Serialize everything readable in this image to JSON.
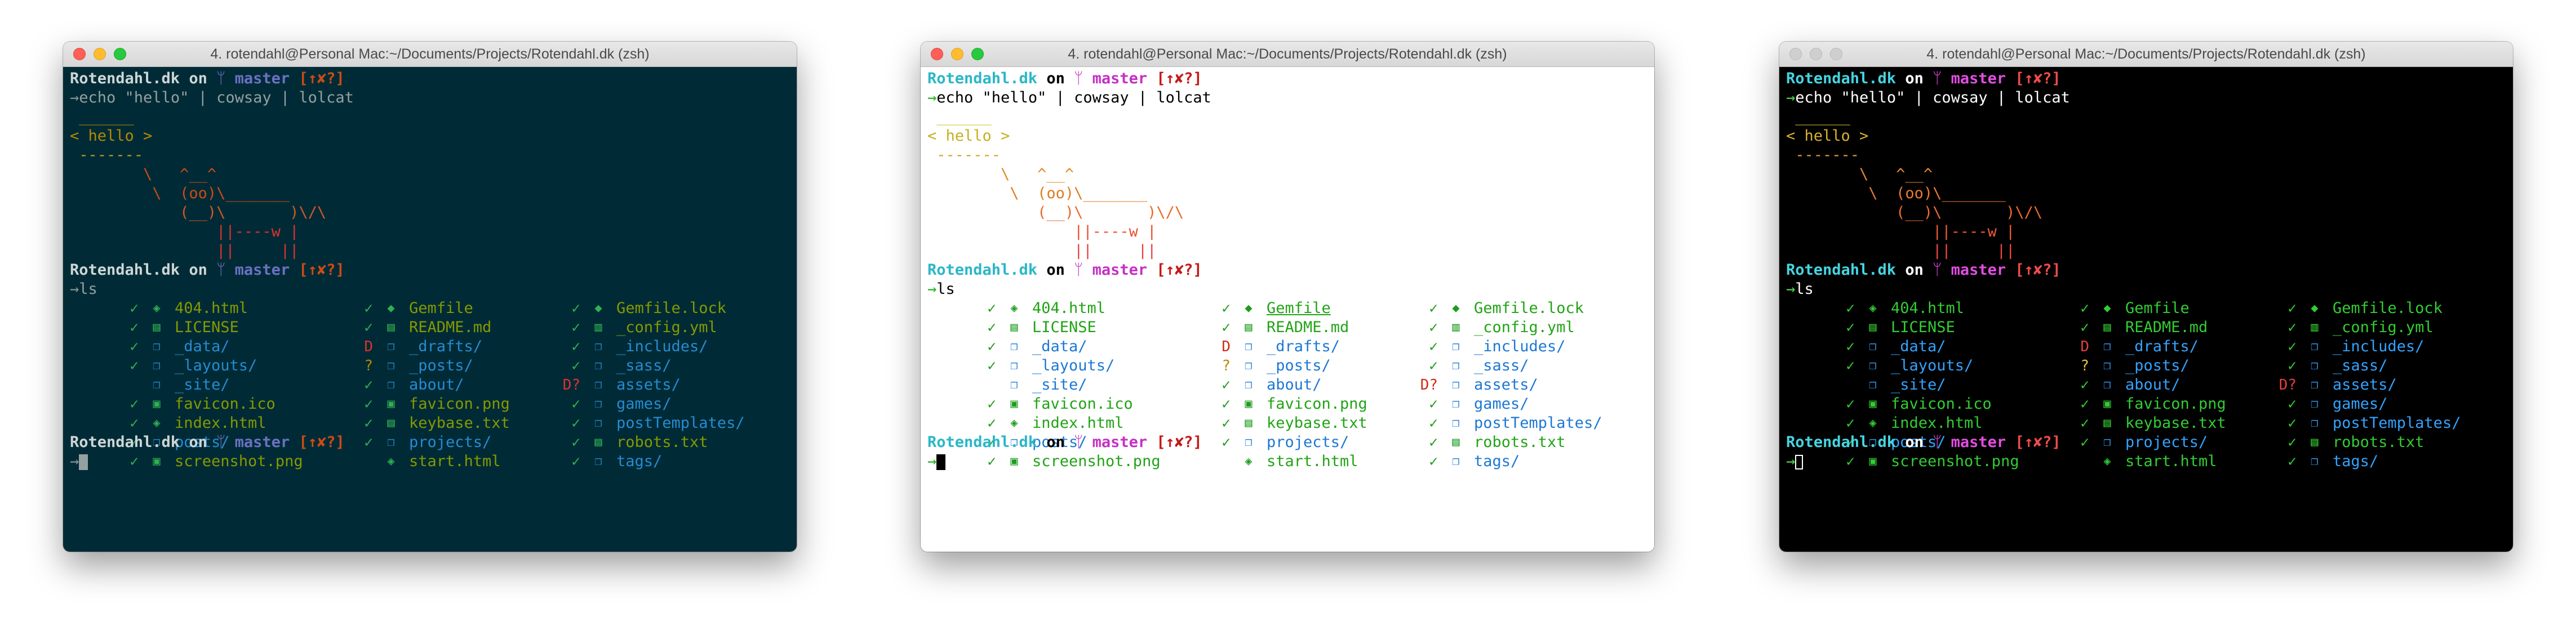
{
  "window_title": "4. rotendahl@Personal Mac:~/Documents/Projects/Rotendahl.dk (zsh)",
  "prompt": {
    "dir": "Rotendahl.dk",
    "on": "on",
    "branch_icon": "ᛘ",
    "branch": "master",
    "status": "[↑✘?]",
    "arrow": "→"
  },
  "command_1": "echo \"hello\" | cowsay | lolcat",
  "cowsay_lines": [
    " ______",
    "< hello >",
    " -------",
    "        \\   ^__^",
    "         \\  (oo)\\_______",
    "            (__)\\       )\\/\\",
    "                ||----w |",
    "                ||     ||"
  ],
  "command_2": "ls",
  "ls_columns": [
    [
      {
        "status": "✓",
        "status_type": "ok",
        "icon": "html-file-icon",
        "glyph": "◈",
        "name": "404.html",
        "type": "file"
      },
      {
        "status": "✓",
        "status_type": "ok",
        "icon": "license-file-icon",
        "glyph": "▤",
        "name": "LICENSE",
        "type": "file"
      },
      {
        "status": "✓",
        "status_type": "ok",
        "icon": "folder-icon",
        "glyph": "❐",
        "name": "_data/",
        "type": "dir"
      },
      {
        "status": "✓",
        "status_type": "ok",
        "icon": "folder-icon",
        "glyph": "❐",
        "name": "_layouts/",
        "type": "dir"
      },
      {
        "status": "",
        "status_type": "none",
        "icon": "folder-icon",
        "glyph": "❐",
        "name": "_site/",
        "type": "dir"
      },
      {
        "status": "✓",
        "status_type": "ok",
        "icon": "image-file-icon",
        "glyph": "▣",
        "name": "favicon.ico",
        "type": "file"
      },
      {
        "status": "✓",
        "status_type": "ok",
        "icon": "html-file-icon",
        "glyph": "◈",
        "name": "index.html",
        "type": "file"
      },
      {
        "status": "✓",
        "status_type": "ok",
        "icon": "folder-icon",
        "glyph": "❐",
        "name": "posts/",
        "type": "dir"
      },
      {
        "status": "✓",
        "status_type": "ok",
        "icon": "image-file-icon",
        "glyph": "▣",
        "name": "screenshot.png",
        "type": "file"
      }
    ],
    [
      {
        "status": "✓",
        "status_type": "ok",
        "icon": "gem-icon",
        "glyph": "◆",
        "name": "Gemfile",
        "type": "file"
      },
      {
        "status": "✓",
        "status_type": "ok",
        "icon": "markdown-file-icon",
        "glyph": "▤",
        "name": "README.md",
        "type": "file"
      },
      {
        "status": "D",
        "status_type": "deleted",
        "icon": "folder-icon",
        "glyph": "❐",
        "name": "_drafts/",
        "type": "dir"
      },
      {
        "status": "?",
        "status_type": "untracked",
        "icon": "folder-icon",
        "glyph": "❐",
        "name": "_posts/",
        "type": "dir"
      },
      {
        "status": "✓",
        "status_type": "ok",
        "icon": "folder-icon",
        "glyph": "❐",
        "name": "about/",
        "type": "dir"
      },
      {
        "status": "✓",
        "status_type": "ok",
        "icon": "image-file-icon",
        "glyph": "▣",
        "name": "favicon.png",
        "type": "file"
      },
      {
        "status": "✓",
        "status_type": "ok",
        "icon": "text-file-icon",
        "glyph": "▤",
        "name": "keybase.txt",
        "type": "file"
      },
      {
        "status": "✓",
        "status_type": "ok",
        "icon": "folder-icon",
        "glyph": "❐",
        "name": "projects/",
        "type": "dir"
      },
      {
        "status": "",
        "status_type": "none",
        "icon": "html-file-icon",
        "glyph": "◈",
        "name": "start.html",
        "type": "file"
      }
    ],
    [
      {
        "status": "✓",
        "status_type": "ok",
        "icon": "gem-icon",
        "glyph": "◆",
        "name": "Gemfile.lock",
        "type": "file"
      },
      {
        "status": "✓",
        "status_type": "ok",
        "icon": "config-file-icon",
        "glyph": "▥",
        "name": "_config.yml",
        "type": "file"
      },
      {
        "status": "✓",
        "status_type": "ok",
        "icon": "folder-icon",
        "glyph": "❐",
        "name": "_includes/",
        "type": "dir"
      },
      {
        "status": "✓",
        "status_type": "ok",
        "icon": "folder-icon",
        "glyph": "❐",
        "name": "_sass/",
        "type": "dir"
      },
      {
        "status": "D?",
        "status_type": "deleted-untracked",
        "icon": "folder-icon",
        "glyph": "❐",
        "name": "assets/",
        "type": "dir"
      },
      {
        "status": "✓",
        "status_type": "ok",
        "icon": "folder-icon",
        "glyph": "❐",
        "name": "games/",
        "type": "dir"
      },
      {
        "status": "✓",
        "status_type": "ok",
        "icon": "folder-icon",
        "glyph": "❐",
        "name": "postTemplates/",
        "type": "dir"
      },
      {
        "status": "✓",
        "status_type": "ok",
        "icon": "text-file-icon",
        "glyph": "▤",
        "name": "robots.txt",
        "type": "file"
      },
      {
        "status": "✓",
        "status_type": "ok",
        "icon": "folder-icon",
        "glyph": "❐",
        "name": "tags/",
        "type": "dir"
      }
    ]
  ],
  "windows": [
    {
      "theme": "dark-teal",
      "traffic_lights": "color",
      "colors": {
        "bg": "#002b36",
        "fg": "#93a1a1",
        "dir": "#cdd6d6",
        "on": "#cdd6d6",
        "branch": "#6c71c4",
        "status": "#cb4b16",
        "arrow": "#839496",
        "command": "#93a1a1",
        "cursor": "#93a1a1",
        "check": "#2fb150",
        "deleted": "#dc322f",
        "untracked": "#b58900",
        "fileicon": "#2fb150",
        "file": "#859900",
        "folder": "#268bd2",
        "dirname": "#268bd2",
        "cow": [
          "#b58900",
          "#b58900",
          "#c79a1f",
          "#cb4b16",
          "#cb4b16",
          "#d4562a",
          "#dc322f",
          "#dc322f"
        ]
      }
    },
    {
      "theme": "light",
      "traffic_lights": "color",
      "colors": {
        "bg": "#ffffff",
        "fg": "#000000",
        "dir": "#2bb7c7",
        "on": "#000000",
        "branch": "#c530c5",
        "status": "#c41a16",
        "arrow": "#25b020",
        "command": "#000000",
        "cursor": "#000000",
        "check": "#1f9c1f",
        "deleted": "#d12a16",
        "untracked": "#b58900",
        "fileicon": "#1f9c1f",
        "file": "#22a316",
        "folder": "#1d78d3",
        "dirname": "#1d78d3",
        "cow": [
          "#c5c520",
          "#c5b020",
          "#d0a520",
          "#e08a20",
          "#e07a20",
          "#e86a28",
          "#ea5030",
          "#ea4040"
        ]
      }
    },
    {
      "theme": "dark",
      "traffic_lights": "gray",
      "colors": {
        "bg": "#000000",
        "fg": "#ffffff",
        "dir": "#46d4e0",
        "on": "#ffffff",
        "branch": "#e24ee2",
        "status": "#ef4b4b",
        "arrow": "#4fd64f",
        "command": "#ffffff",
        "cursor": "#ffffff",
        "check": "#33cc33",
        "deleted": "#e34040",
        "untracked": "#e8c33a",
        "fileicon": "#33cc33",
        "file": "#33cc33",
        "folder": "#33a3ff",
        "dirname": "#33a3ff",
        "cow": [
          "#d4c430",
          "#d8b030",
          "#e0a030",
          "#e88a30",
          "#ea7a30",
          "#ee6a30",
          "#f05a38",
          "#f04848"
        ]
      }
    }
  ]
}
